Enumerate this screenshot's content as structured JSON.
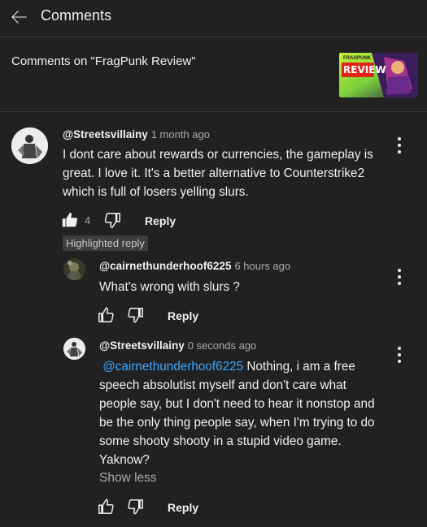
{
  "header": {
    "title": "Comments"
  },
  "video": {
    "title": "Comments on \"FragPunk Review\"",
    "thumb_brand": "FRAGPUNK",
    "thumb_label": "REVIEW"
  },
  "comments": {
    "main": {
      "author": "@Streetsvillainy",
      "time": "1 month ago",
      "lines": [
        "I dont care about rewards or currencies, the gameplay is",
        "great. I love it. It's a better alternative to Counterstrike2",
        "which is full of losers yelling slurs."
      ],
      "likes": "4",
      "reply_label": "Reply",
      "badge": "Highlighted reply"
    },
    "reply1": {
      "author": "@cairnethunderhoof6225",
      "time": "6 hours ago",
      "text": "What's wrong with slurs ?",
      "reply_label": "Reply"
    },
    "reply2": {
      "author": "@Streetsvillainy",
      "time": "0 seconds ago",
      "mention": "@cairnethunderhoof6225",
      "first_line_rest": " Nothing, i am a free",
      "lines": [
        "speech absolutist myself and don't care what",
        "people say, but I don't need to hear it nonstop and",
        "be the only thing people say, when I'm trying to do",
        "some shooty shooty in a stupid video game.",
        "Yaknow?"
      ],
      "show_less": "Show less",
      "reply_label": "Reply"
    }
  },
  "icons": {
    "back": "arrow-left-icon",
    "more": "more-vert-icon",
    "like": "thumb-up-icon",
    "dislike": "thumb-down-icon"
  },
  "colors": {
    "background": "#212121",
    "mention": "#3ea6ff",
    "muted": "#aaaaaa",
    "badge_bg": "#3d3d3d"
  }
}
